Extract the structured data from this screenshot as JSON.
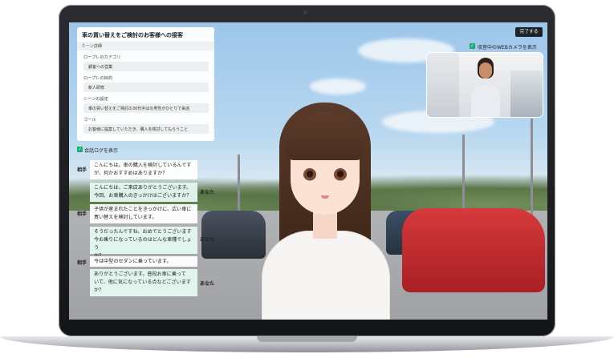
{
  "scene": {
    "title": "車の買い替えをご検討のお客様への接客",
    "section_label": "シーン詳細",
    "roleplay_category_label": "ロープレのカテゴリ",
    "roleplay_category_value": "顧客への営業",
    "roleplay_goal_label": "ロープレの目的",
    "roleplay_goal_value": "新人研修",
    "scene_setting_label": "シーンの設定",
    "scene_setting_value": "車の買い替えをご検討の30代半ばの男性がひとりで来店",
    "goal_label": "ゴール",
    "goal_value": "お客様に提案していただき、購入を検討してもらうこと"
  },
  "log": {
    "toggle_label": "会話ログを表示",
    "other_label": "相手",
    "me_label": "あなた",
    "messages": [
      {
        "who": "相手",
        "l1": "こんにちは。車の購入を検討しているんです",
        "l2": "が、何かおすすめはありますか？",
        "l3": ""
      },
      {
        "who": "あなた",
        "l1": "こんにちは、ご来店ありがとうございます。",
        "l2": "今回、お車購入のきっかけはございますか？",
        "l3": ""
      },
      {
        "who": "相手",
        "l1": "子供が産まれたことをきっかけに、広い車に",
        "l2": "買い替えを検討しています。",
        "l3": ""
      },
      {
        "who": "あなた",
        "l1": "そうだったんですね、おめでとうございます",
        "l2": "今お乗りになっているのはどんな車種でしょう",
        "l3": "か？"
      },
      {
        "who": "相手",
        "l1": "今は中型のセダンに乗っています。",
        "l2": "",
        "l3": ""
      },
      {
        "who": "あなた",
        "l1": "ありがとうございます。普段お車に乗って",
        "l2": "いて、他に気になっている点などございます",
        "l3": "か？"
      }
    ]
  },
  "controls": {
    "done_button": "完了する",
    "webcam_toggle_label": "収音中のWEBカメラを表示"
  },
  "colors": {
    "accent": "#19a974",
    "button_dark": "#1f2226"
  }
}
